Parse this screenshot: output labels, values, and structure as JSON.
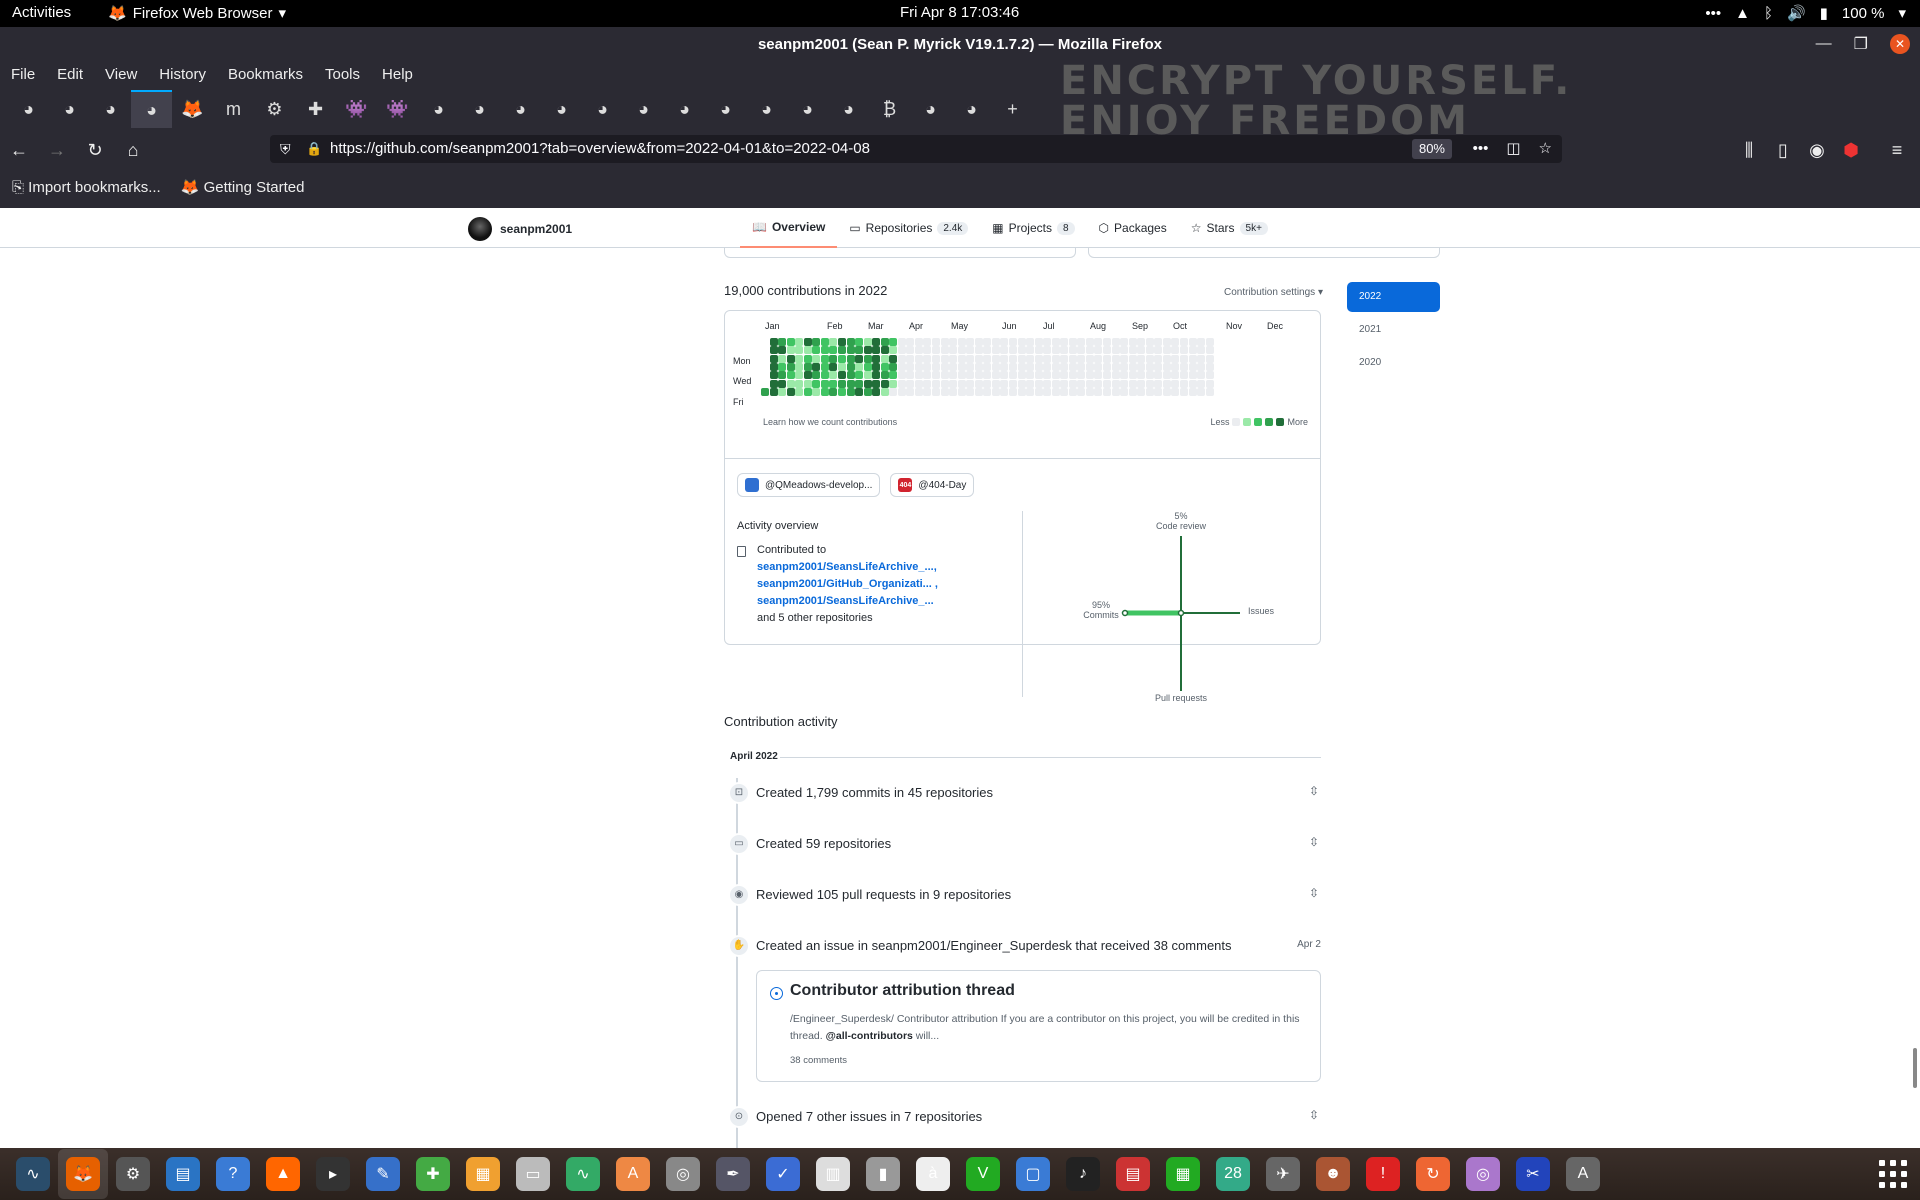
{
  "topbar": {
    "activities": "Activities",
    "app_name": "Firefox Web Browser",
    "clock": "Fri Apr 8  17:03:46",
    "battery": "100 %"
  },
  "window": {
    "title": "seanpm2001 (Sean P. Myrick V19.1.7.2) — Mozilla Firefox"
  },
  "menubar": [
    "File",
    "Edit",
    "View",
    "History",
    "Bookmarks",
    "Tools",
    "Help"
  ],
  "theme_text": [
    "ENCRYPT YOURSELF.",
    "ENJOY FREEDOM"
  ],
  "tabs": [
    "github",
    "github",
    "github",
    "github",
    "firefox",
    "m",
    "gear",
    "puzzle",
    "alien",
    "alien",
    "github",
    "github",
    "github",
    "github",
    "github",
    "github",
    "github",
    "github",
    "github",
    "github",
    "github",
    "bitcoin",
    "github",
    "github"
  ],
  "urlbar": {
    "url": "https://github.com/seanpm2001?tab=overview&from=2022-04-01&to=2022-04-08",
    "zoom": "80%"
  },
  "bookmarks": [
    "Import bookmarks...",
    "Getting Started"
  ],
  "profile": {
    "username": "seanpm2001",
    "tabs": [
      {
        "label": "Overview",
        "count": ""
      },
      {
        "label": "Repositories",
        "count": "2.4k"
      },
      {
        "label": "Projects",
        "count": "8"
      },
      {
        "label": "Packages",
        "count": ""
      },
      {
        "label": "Stars",
        "count": "5k+"
      }
    ]
  },
  "contributions": {
    "title": "19,000 contributions in 2022",
    "settings": "Contribution settings ▾",
    "months": [
      "Jan",
      "Feb",
      "Mar",
      "Apr",
      "May",
      "Jun",
      "Jul",
      "Aug",
      "Sep",
      "Oct",
      "Nov",
      "Dec"
    ],
    "days": [
      "Mon",
      "Wed",
      "Fri"
    ],
    "learn": "Learn how we count contributions",
    "less": "Less",
    "more": "More",
    "colors": [
      "#ebedf0",
      "#9be9a8",
      "#40c463",
      "#30a14e",
      "#216e39"
    ]
  },
  "orgs": [
    {
      "name": "@QMeadows-develop...",
      "color": "#2f6fd1"
    },
    {
      "name": "@404-Day",
      "color": "#d1242f",
      "logo_text": "404"
    }
  ],
  "activity_overview": {
    "title": "Activity overview",
    "contributed_to": "Contributed to",
    "repos": [
      "seanpm2001/SeansLifeArchive_...,",
      "seanpm2001/GitHub_Organizati... ,",
      "seanpm2001/SeansLifeArchive_..."
    ],
    "other": "and 5 other repositories",
    "radar": {
      "code_review_pct": "5%",
      "code_review": "Code review",
      "commits_pct": "95%",
      "commits": "Commits",
      "issues": "Issues",
      "pull_requests": "Pull requests"
    }
  },
  "activity": {
    "title": "Contribution activity",
    "month": "April 2022",
    "items": [
      {
        "text": "Created 1,799 commits in 45 repositories",
        "date": ""
      },
      {
        "text": "Created 59 repositories",
        "date": ""
      },
      {
        "text": "Reviewed 105 pull requests in 9 repositories",
        "date": ""
      },
      {
        "text": "Created an issue in seanpm2001/Engineer_Superdesk that received 38 comments",
        "date": "Apr 2"
      },
      {
        "text": "Opened 7 other issues in 7 repositories",
        "date": ""
      }
    ],
    "issue": {
      "title": "Contributor attribution thread",
      "body_prefix": "/Engineer_Superdesk/ Contributor attribution If you are a contributor on this project, you will be credited in this thread.",
      "mention": "@all-contributors",
      "body_suffix": "will...",
      "comments": "38 comments"
    }
  },
  "years": [
    "2022",
    "2021",
    "2020"
  ]
}
